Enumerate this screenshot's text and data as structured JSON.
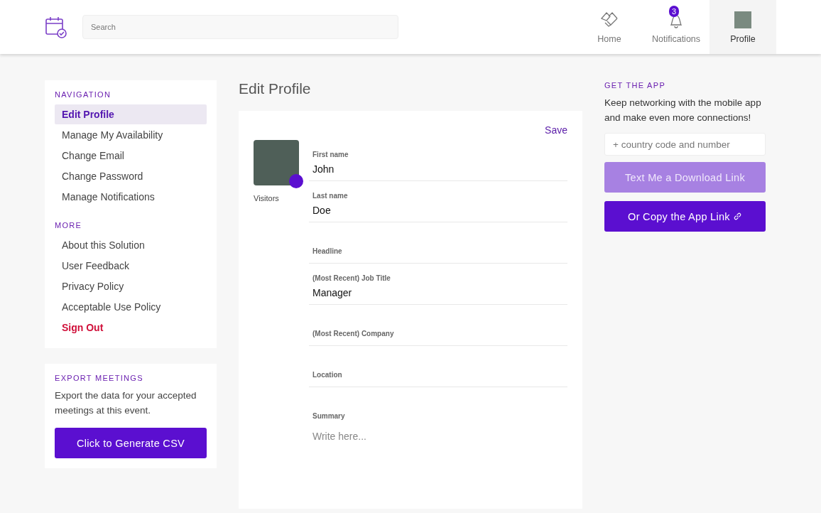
{
  "header": {
    "search": {
      "placeholder": "Search"
    },
    "nav": [
      {
        "kind": "home",
        "label": "Home",
        "selected": false
      },
      {
        "kind": "bell",
        "label": "Notifications",
        "badge": "3",
        "selected": false
      },
      {
        "kind": "avatar",
        "label": "Profile",
        "selected": true
      }
    ]
  },
  "sidebar": {
    "sections": [
      {
        "title": "NAVIGATION",
        "items": [
          {
            "label": "Edit Profile",
            "selected": true,
            "kind": "link"
          },
          {
            "label": "Manage My Availability",
            "selected": false,
            "kind": "link"
          },
          {
            "label": "Change Email",
            "selected": false,
            "kind": "link"
          },
          {
            "label": "Change Password",
            "selected": false,
            "kind": "link"
          },
          {
            "label": "Manage Notifications",
            "selected": false,
            "kind": "link"
          }
        ]
      },
      {
        "title": "MORE",
        "items": [
          {
            "label": "About this Solution",
            "selected": false,
            "kind": "link"
          },
          {
            "label": "User Feedback",
            "selected": false,
            "kind": "link"
          },
          {
            "label": "Privacy Policy",
            "selected": false,
            "kind": "link"
          },
          {
            "label": "Acceptable Use Policy",
            "selected": false,
            "kind": "link"
          },
          {
            "label": "Sign Out",
            "selected": false,
            "kind": "danger"
          }
        ]
      }
    ],
    "export": {
      "title": "EXPORT MEETINGS",
      "text": "Export the data for your accepted meetings at this event.",
      "button": "Click to Generate CSV"
    }
  },
  "main": {
    "title": "Edit Profile",
    "save": "Save",
    "avatar_caption": "Visitors",
    "fields": [
      {
        "label": "First name",
        "value": "John"
      },
      {
        "label": "Last name",
        "value": "Doe"
      },
      {
        "label": "Headline"
      },
      {
        "label": "(Most Recent) Job Title",
        "value": "Manager"
      },
      {
        "label": "(Most Recent) Company"
      },
      {
        "label": "Location"
      }
    ],
    "summary": {
      "label": "Summary",
      "placeholder": "Write here..."
    }
  },
  "app": {
    "title": "GET THE APP",
    "text": "Keep networking with the mobile app and make even more connections!",
    "phone": {
      "placeholder": "+ country code and number"
    },
    "send_button": {
      "label": "Text Me a Download Link",
      "disabled": true
    },
    "copy_button": {
      "label": "Or Copy the App Link"
    }
  }
}
